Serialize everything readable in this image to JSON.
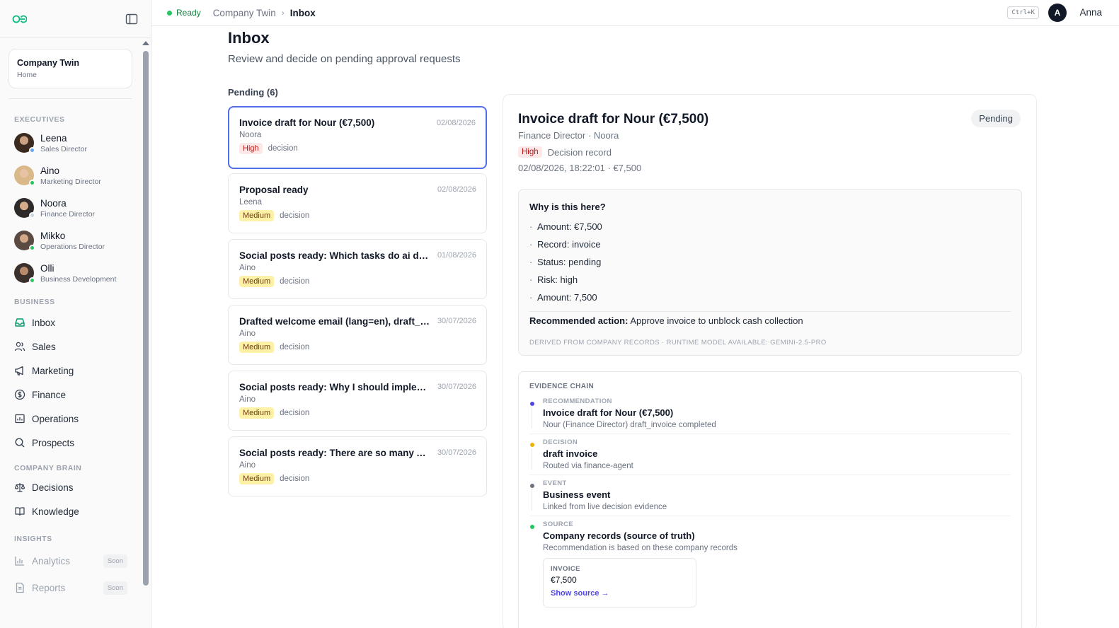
{
  "app": {
    "status": "Ready",
    "breadcrumb": [
      "Company Twin",
      "Inbox"
    ],
    "shortcut": "Ctrl+K",
    "user": {
      "initial": "A",
      "name": "Anna"
    }
  },
  "sidebar": {
    "home": {
      "title": "Company Twin",
      "subtitle": "Home"
    },
    "sections": {
      "executives": "EXECUTIVES",
      "business": "BUSINESS",
      "company_brain": "COMPANY BRAIN",
      "insights": "INSIGHTS"
    },
    "executives": [
      {
        "name": "Leena",
        "role": "Sales Director",
        "status": "blue"
      },
      {
        "name": "Aino",
        "role": "Marketing Director",
        "status": "green"
      },
      {
        "name": "Noora",
        "role": "Finance Director",
        "status": "gray"
      },
      {
        "name": "Mikko",
        "role": "Operations Director",
        "status": "green"
      },
      {
        "name": "Olli",
        "role": "Business Development",
        "status": "green"
      }
    ],
    "business": [
      {
        "label": "Inbox",
        "icon": "inbox-icon"
      },
      {
        "label": "Sales",
        "icon": "users-icon"
      },
      {
        "label": "Marketing",
        "icon": "megaphone-icon"
      },
      {
        "label": "Finance",
        "icon": "dollar-icon"
      },
      {
        "label": "Operations",
        "icon": "chart-icon"
      },
      {
        "label": "Prospects",
        "icon": "search-icon"
      }
    ],
    "brain": [
      {
        "label": "Decisions",
        "icon": "scale-icon"
      },
      {
        "label": "Knowledge",
        "icon": "book-icon"
      }
    ],
    "insights": [
      {
        "label": "Analytics",
        "icon": "bar-chart-icon",
        "badge": "Soon"
      },
      {
        "label": "Reports",
        "icon": "document-icon",
        "badge": "Soon"
      }
    ]
  },
  "main": {
    "title": "Inbox",
    "subtitle": "Review and decide on pending approval requests",
    "pending_label": "Pending (6)",
    "items": [
      {
        "title": "Invoice draft for Nour (€7,500)",
        "date": "02/08/2026",
        "from": "Noora",
        "priority": "High",
        "kind": "decision"
      },
      {
        "title": "Proposal ready",
        "date": "02/08/2026",
        "from": "Leena",
        "priority": "Medium",
        "kind": "decision"
      },
      {
        "title": "Social posts ready: Which tasks do ai do th...",
        "date": "01/08/2026",
        "from": "Aino",
        "priority": "Medium",
        "kind": "decision"
      },
      {
        "title": "Drafted welcome email (lang=en), draft_id...",
        "date": "30/07/2026",
        "from": "Aino",
        "priority": "Medium",
        "kind": "decision"
      },
      {
        "title": "Social posts ready: Why I should implemen...",
        "date": "30/07/2026",
        "from": "Aino",
        "priority": "Medium",
        "kind": "decision"
      },
      {
        "title": "Social posts ready: There are so many AI s...",
        "date": "30/07/2026",
        "from": "Aino",
        "priority": "Medium",
        "kind": "decision"
      }
    ]
  },
  "detail": {
    "title": "Invoice draft for Nour (€7,500)",
    "status": "Pending",
    "meta": "Finance Director · Noora",
    "priority": "High",
    "kind": "Decision record",
    "timestamp": "02/08/2026, 18:22:01 · €7,500",
    "why": {
      "heading": "Why is this here?",
      "reasons": [
        "Amount: €7,500",
        "Record: invoice",
        "Status: pending",
        "Risk: high",
        "Amount: 7,500"
      ],
      "recommended_label": "Recommended action:",
      "recommended_text": "Approve invoice to unblock cash collection",
      "footer": "DERIVED FROM COMPANY RECORDS · RUNTIME MODEL AVAILABLE: GEMINI-2.5-PRO"
    },
    "evidence": {
      "heading": "EVIDENCE CHAIN",
      "items": [
        {
          "label": "RECOMMENDATION",
          "title": "Invoice draft for Nour (€7,500)",
          "desc": "Nour (Finance Director) draft_invoice completed",
          "color": "#4f46e5"
        },
        {
          "label": "DECISION",
          "title": "draft invoice",
          "desc": "Routed via finance-agent",
          "color": "#eab308"
        },
        {
          "label": "EVENT",
          "title": "Business event",
          "desc": "Linked from live decision evidence",
          "color": "#6b7280"
        },
        {
          "label": "SOURCE",
          "title": "Company records (source of truth)",
          "desc": "Recommendation is based on these company records",
          "color": "#22c55e"
        }
      ],
      "source_card": {
        "type": "INVOICE",
        "value": "€7,500",
        "link": "Show source →"
      }
    }
  }
}
